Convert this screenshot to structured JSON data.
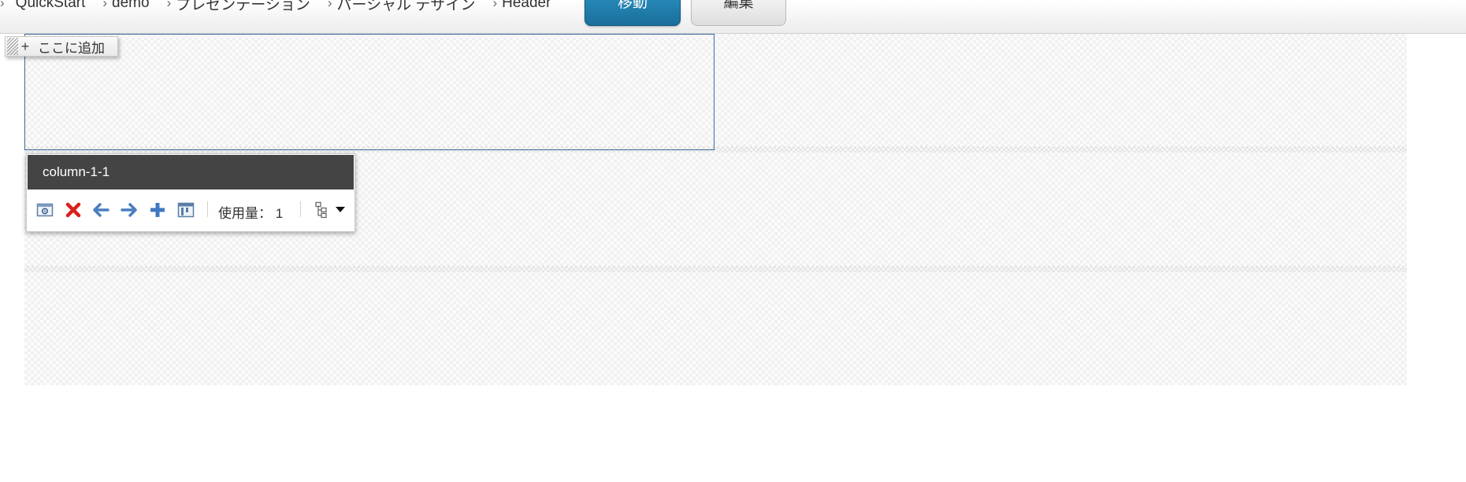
{
  "breadcrumb": {
    "items": [
      {
        "label": "QuickStart"
      },
      {
        "label": "demo"
      },
      {
        "label": "プレゼンテーション"
      },
      {
        "label": "パーシャル デザイン"
      },
      {
        "label": "Header"
      }
    ]
  },
  "toolbar": {
    "move_label": "移動",
    "edit_label": "編集"
  },
  "canvas": {
    "add_here_label": "ここに追加"
  },
  "column_panel": {
    "title": "column-1-1",
    "usage_label": "使用量：",
    "usage_value": "1",
    "tools": [
      {
        "name": "properties-icon"
      },
      {
        "name": "delete-icon"
      },
      {
        "name": "arrow-left-icon"
      },
      {
        "name": "arrow-right-icon"
      },
      {
        "name": "plus-icon"
      },
      {
        "name": "layout-icon"
      },
      {
        "name": "tree-icon"
      },
      {
        "name": "caret-down-icon"
      }
    ]
  },
  "colors": {
    "move_button": "#1f7fae",
    "panel_header": "#444444",
    "delete_red": "#d9211c",
    "arrow_blue": "#4a7fc0",
    "selection_border": "#3d6a9e"
  }
}
